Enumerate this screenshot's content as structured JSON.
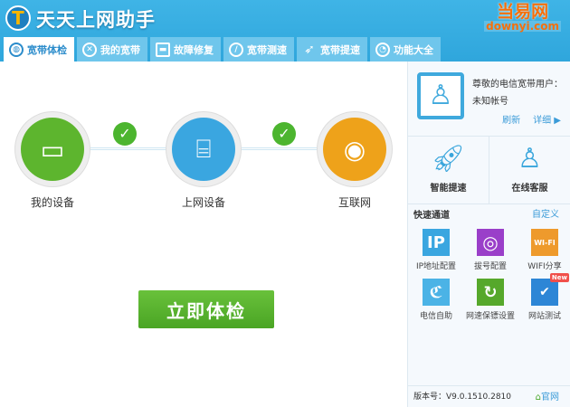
{
  "app": {
    "title": "天天上网助手",
    "brand_top": "当易网",
    "brand_bottom": "downyi.com"
  },
  "tabs": [
    {
      "label": "宽带体检",
      "icon": "globe-icon"
    },
    {
      "label": "我的宽带",
      "icon": "network-icon"
    },
    {
      "label": "故障修复",
      "icon": "toolbox-icon"
    },
    {
      "label": "宽带测速",
      "icon": "speedometer-icon"
    },
    {
      "label": "宽带提速",
      "icon": "rocket-icon"
    },
    {
      "label": "功能大全",
      "icon": "apps-icon"
    }
  ],
  "main": {
    "nodes": [
      {
        "label": "我的设备",
        "color": "#5db52e"
      },
      {
        "label": "上网设备",
        "color": "#3aa6e0"
      },
      {
        "label": "互联网",
        "color": "#eea21a"
      }
    ],
    "check_button": "立即体检"
  },
  "side": {
    "greeting": "尊敬的电信宽带用户：",
    "account": "未知帐号",
    "refresh": "刷新",
    "detail": "详细 ▶",
    "big": [
      {
        "label": "智能提速"
      },
      {
        "label": "在线客服"
      }
    ],
    "quick_title": "快速通道",
    "customize": "自定义",
    "quick": [
      {
        "label": "IP地址配置",
        "glyph": "IP",
        "color": "#3aa6e0"
      },
      {
        "label": "拔号配置",
        "glyph": "◎",
        "color": "#9a3fc9"
      },
      {
        "label": "WIFI分享",
        "glyph": "WI-FI",
        "color": "#ee9a2c"
      },
      {
        "label": "电信自助",
        "glyph": "ℭ",
        "color": "#4bb3e6"
      },
      {
        "label": "网速保镖设置",
        "glyph": "↻",
        "color": "#56a82b"
      },
      {
        "label": "网站测试",
        "glyph": "✔",
        "color": "#2d86d6",
        "badge": "New"
      }
    ],
    "version": "版本号：V9.0.1510.2810",
    "website": "官网"
  }
}
